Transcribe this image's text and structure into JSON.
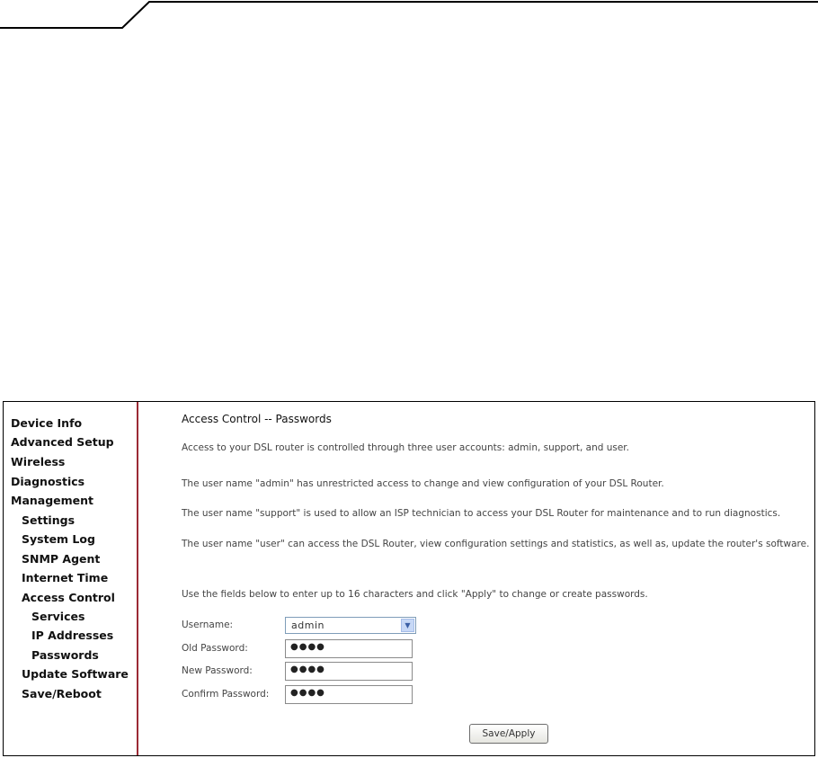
{
  "sidebar": {
    "items": [
      {
        "label": "Device Info"
      },
      {
        "label": "Advanced Setup"
      },
      {
        "label": "Wireless"
      },
      {
        "label": "Diagnostics"
      },
      {
        "label": "Management"
      },
      {
        "label": "Settings"
      },
      {
        "label": "System Log"
      },
      {
        "label": "SNMP Agent"
      },
      {
        "label": "Internet Time"
      },
      {
        "label": "Access Control"
      },
      {
        "label": "Services"
      },
      {
        "label": "IP Addresses"
      },
      {
        "label": "Passwords"
      },
      {
        "label": "Update Software"
      },
      {
        "label": "Save/Reboot"
      }
    ]
  },
  "main": {
    "title": "Access Control -- Passwords",
    "paragraphs": [
      "Access to your DSL router is controlled through three user accounts: admin, support, and user.",
      "The user name \"admin\" has unrestricted access to change and view configuration of your DSL Router.",
      "The user name \"support\" is used to allow an ISP technician to access your DSL Router for maintenance and to run diagnostics.",
      "The user name \"user\" can access the DSL Router, view configuration settings and statistics, as well as, update the router's software.",
      "Use the fields below to enter up to 16 characters and click \"Apply\" to change or create passwords."
    ]
  },
  "form": {
    "username_label": "Username:",
    "username_value": "admin",
    "old_password_label": "Old Password:",
    "old_password_value": "●●●●",
    "new_password_label": "New Password:",
    "new_password_value": "●●●●",
    "confirm_password_label": "Confirm Password:",
    "confirm_password_value": "●●●●",
    "save_button": "Save/Apply"
  },
  "colors": {
    "divider": "#9b2a35",
    "select_arrow": "#c7d8f6"
  }
}
